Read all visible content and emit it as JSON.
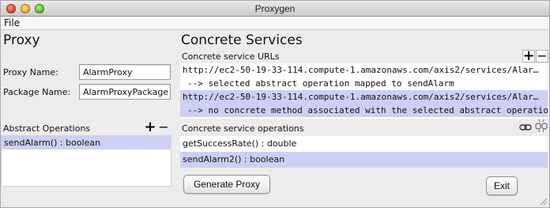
{
  "window": {
    "title": "Proxygen"
  },
  "menu": {
    "file": "File"
  },
  "proxy": {
    "heading": "Proxy",
    "proxy_name_label": "Proxy Name:",
    "proxy_name_value": "AlarmProxy",
    "package_name_label": "Package Name:",
    "package_name_value": "AlarmProxyPackage",
    "abstract_ops_label": "Abstract Operations",
    "abstract_ops": [
      "sendAlarm() : boolean"
    ]
  },
  "services": {
    "heading": "Concrete Services",
    "urls_label": "Concrete service URLs",
    "urls": [
      {
        "text": "http://ec2-50-19-33-114.compute-1.amazonaws.com/axis2/services/Alar…",
        "selected": false,
        "indent": false
      },
      {
        "text": "--> selected abstract operation mapped to sendAlarm",
        "selected": false,
        "indent": true
      },
      {
        "text": "http://ec2-50-19-33-114.compute-1.amazonaws.com/axis2/services/Alar…",
        "selected": true,
        "indent": false
      },
      {
        "text": "--> no concrete method associated with the selected abstract operation",
        "selected": true,
        "indent": true
      }
    ],
    "ops_label": "Concrete service operations",
    "ops": [
      {
        "text": "getSuccessRate() : double",
        "selected": false
      },
      {
        "text": "sendAlarm2() : boolean",
        "selected": true
      }
    ]
  },
  "buttons": {
    "generate": "Generate Proxy",
    "exit": "Exit"
  },
  "icons": {
    "add": "plus-icon",
    "remove": "minus-icon",
    "link": "link-icon",
    "unlink": "unlink-icon"
  }
}
